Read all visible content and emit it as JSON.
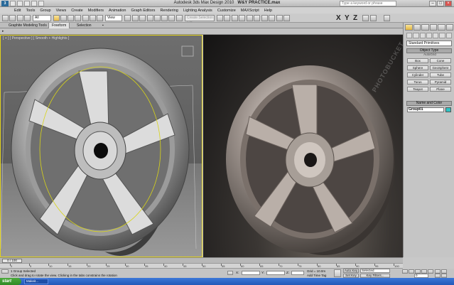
{
  "window": {
    "title": "Autodesk 3ds Max Design 2010",
    "file": "W&Y PRACTICE.max",
    "search_placeholder": "Type a keyword or phrase"
  },
  "menu": [
    "Edit",
    "Tools",
    "Group",
    "Views",
    "Create",
    "Modifiers",
    "Animation",
    "Graph Editors",
    "Rendering",
    "Lighting Analysis",
    "Customize",
    "MAXScript",
    "Help"
  ],
  "toolbar": {
    "selection_filter": "All",
    "coord_system": "View",
    "named_selection": "Create Selection Set",
    "axes": [
      "X",
      "Y",
      "Z"
    ]
  },
  "ribbon": {
    "tabs": [
      "Graphite Modeling Tools",
      "Freeform",
      "Selection"
    ],
    "active_tab": "Freeform"
  },
  "viewport": {
    "label": "[ + ] [ Perspective ] [ Smooth + Highlights ]",
    "watermark": "PHOTOBUCKET"
  },
  "command_panel": {
    "category": "Standard Primitives",
    "object_type_title": "Object Type",
    "autogrid": "AutoGrid",
    "primitives": [
      "Box",
      "Cone",
      "Sphere",
      "GeoSphere",
      "Cylinder",
      "Tube",
      "Torus",
      "Pyramid",
      "Teapot",
      "Plane"
    ],
    "name_color_title": "Name and Color",
    "object_name": "Group01",
    "object_color": "#2ec4c4"
  },
  "timeline": {
    "slider": "0 / 100",
    "ticks": [
      "0",
      "5",
      "10",
      "15",
      "20",
      "25",
      "30",
      "35",
      "40",
      "45",
      "50",
      "55",
      "60",
      "65",
      "70",
      "75",
      "80",
      "85",
      "90",
      "95",
      "100"
    ]
  },
  "status": {
    "selection": "1 Group Selected",
    "prompt": "Click and drag to rotate the view.  Clicking in the tabs constrains the rotation",
    "x_label": "X:",
    "y_label": "Y:",
    "z_label": "Z:",
    "grid": "Grid = 10.0m",
    "add_time_tag": "Add Time Tag",
    "auto_key": "Auto Key",
    "set_key": "Set Key",
    "key_mode": "Selected",
    "key_filters": "Key Filters...",
    "frame": "0"
  },
  "taskbar": {
    "start": "start",
    "item": "Makeit..."
  }
}
